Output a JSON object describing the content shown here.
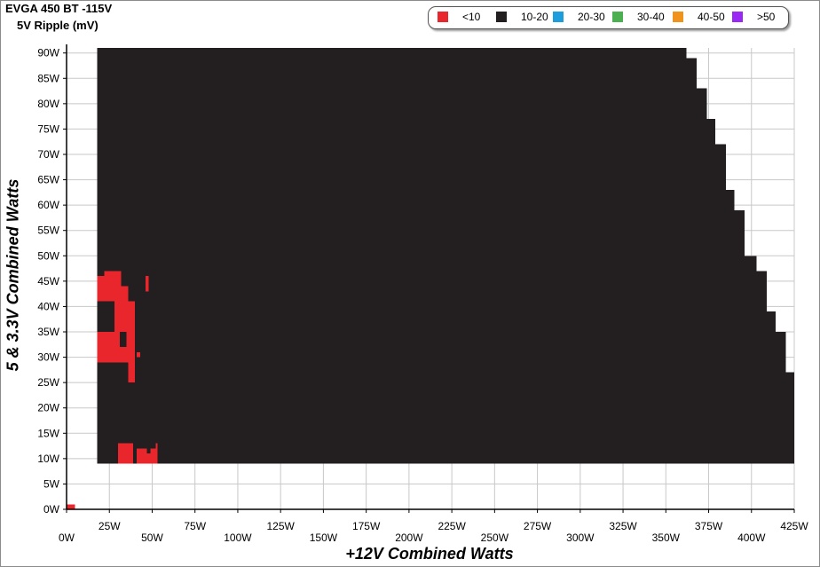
{
  "title": "EVGA 450 BT -115V",
  "subtitle": "5V Ripple (mV)",
  "legend": [
    {
      "label": "<10",
      "color": "#e8262c"
    },
    {
      "label": "10-20",
      "color": "#231f20"
    },
    {
      "label": "20-30",
      "color": "#1b9edb"
    },
    {
      "label": "30-40",
      "color": "#4caf50"
    },
    {
      "label": "40-50",
      "color": "#f0931c"
    },
    {
      "label": ">50",
      "color": "#9b27f5"
    }
  ],
  "chart_data": {
    "type": "heatmap",
    "title": "EVGA 450 BT -115V",
    "subtitle": "5V Ripple (mV)",
    "xlabel": "+12V Combined Watts",
    "ylabel": "5 & 3.3V Combined Watts",
    "xlim": [
      0,
      425
    ],
    "ylim": [
      0,
      90
    ],
    "x_ticks": [
      0,
      25,
      50,
      75,
      100,
      125,
      150,
      175,
      200,
      225,
      250,
      275,
      300,
      325,
      350,
      375,
      400,
      425
    ],
    "x_tick_labels": [
      "0W",
      "25W",
      "50W",
      "75W",
      "100W",
      "125W",
      "150W",
      "175W",
      "200W",
      "225W",
      "250W",
      "275W",
      "300W",
      "325W",
      "350W",
      "375W",
      "400W",
      "425W"
    ],
    "y_ticks": [
      0,
      5,
      10,
      15,
      20,
      25,
      30,
      35,
      40,
      45,
      50,
      55,
      60,
      65,
      70,
      75,
      80,
      85,
      90
    ],
    "y_tick_labels": [
      "0W",
      "5W",
      "10W",
      "15W",
      "20W",
      "25W",
      "30W",
      "35W",
      "40W",
      "45W",
      "50W",
      "55W",
      "60W",
      "65W",
      "70W",
      "75W",
      "80W",
      "85W",
      "90W"
    ],
    "grid": true,
    "legend_position": "top-right",
    "bins": [
      "<10",
      "10-20",
      "20-30",
      "30-40",
      "40-50",
      ">50"
    ],
    "regions": [
      {
        "bin": "<10",
        "x": [
          0,
          5
        ],
        "y": [
          0,
          1
        ]
      },
      {
        "bin": "10-20",
        "x": [
          18,
          362
        ],
        "y": [
          9,
          91
        ]
      },
      {
        "bin": "10-20",
        "x": [
          362,
          368
        ],
        "y": [
          9,
          89
        ]
      },
      {
        "bin": "10-20",
        "x": [
          368,
          374
        ],
        "y": [
          9,
          83
        ]
      },
      {
        "bin": "10-20",
        "x": [
          374,
          379
        ],
        "y": [
          9,
          77
        ]
      },
      {
        "bin": "10-20",
        "x": [
          379,
          385
        ],
        "y": [
          9,
          72
        ]
      },
      {
        "bin": "10-20",
        "x": [
          385,
          390
        ],
        "y": [
          9,
          63
        ]
      },
      {
        "bin": "10-20",
        "x": [
          390,
          396
        ],
        "y": [
          9,
          59
        ]
      },
      {
        "bin": "10-20",
        "x": [
          396,
          403
        ],
        "y": [
          9,
          50
        ]
      },
      {
        "bin": "10-20",
        "x": [
          403,
          409
        ],
        "y": [
          9,
          47
        ]
      },
      {
        "bin": "10-20",
        "x": [
          409,
          414
        ],
        "y": [
          9,
          39
        ]
      },
      {
        "bin": "10-20",
        "x": [
          414,
          420
        ],
        "y": [
          9,
          35
        ]
      },
      {
        "bin": "10-20",
        "x": [
          420,
          425
        ],
        "y": [
          9,
          27
        ]
      },
      {
        "bin": "<10",
        "x": [
          18,
          32
        ],
        "y": [
          41,
          46
        ]
      },
      {
        "bin": "<10",
        "x": [
          22,
          32
        ],
        "y": [
          46,
          47
        ]
      },
      {
        "bin": "<10",
        "x": [
          32,
          36
        ],
        "y": [
          41,
          44
        ]
      },
      {
        "bin": "<10",
        "x": [
          28,
          40
        ],
        "y": [
          29,
          41
        ]
      },
      {
        "bin": "<10",
        "x": [
          18,
          28
        ],
        "y": [
          29,
          35
        ]
      },
      {
        "bin": "<10",
        "x": [
          36,
          40
        ],
        "y": [
          25,
          29
        ]
      },
      {
        "bin": "<10",
        "x": [
          41,
          43
        ],
        "y": [
          30,
          31
        ]
      },
      {
        "bin": "<10",
        "x": [
          46,
          48
        ],
        "y": [
          43,
          46
        ]
      },
      {
        "bin": "<10",
        "x": [
          30,
          39
        ],
        "y": [
          9,
          13
        ]
      },
      {
        "bin": "<10",
        "x": [
          41,
          47
        ],
        "y": [
          9,
          12
        ]
      },
      {
        "bin": "<10",
        "x": [
          47,
          49
        ],
        "y": [
          9,
          11
        ]
      },
      {
        "bin": "<10",
        "x": [
          49,
          52
        ],
        "y": [
          9,
          12
        ]
      },
      {
        "bin": "<10",
        "x": [
          52,
          53
        ],
        "y": [
          9,
          13
        ]
      },
      {
        "bin": "10-20",
        "x": [
          31,
          35
        ],
        "y": [
          32,
          35
        ]
      }
    ]
  }
}
